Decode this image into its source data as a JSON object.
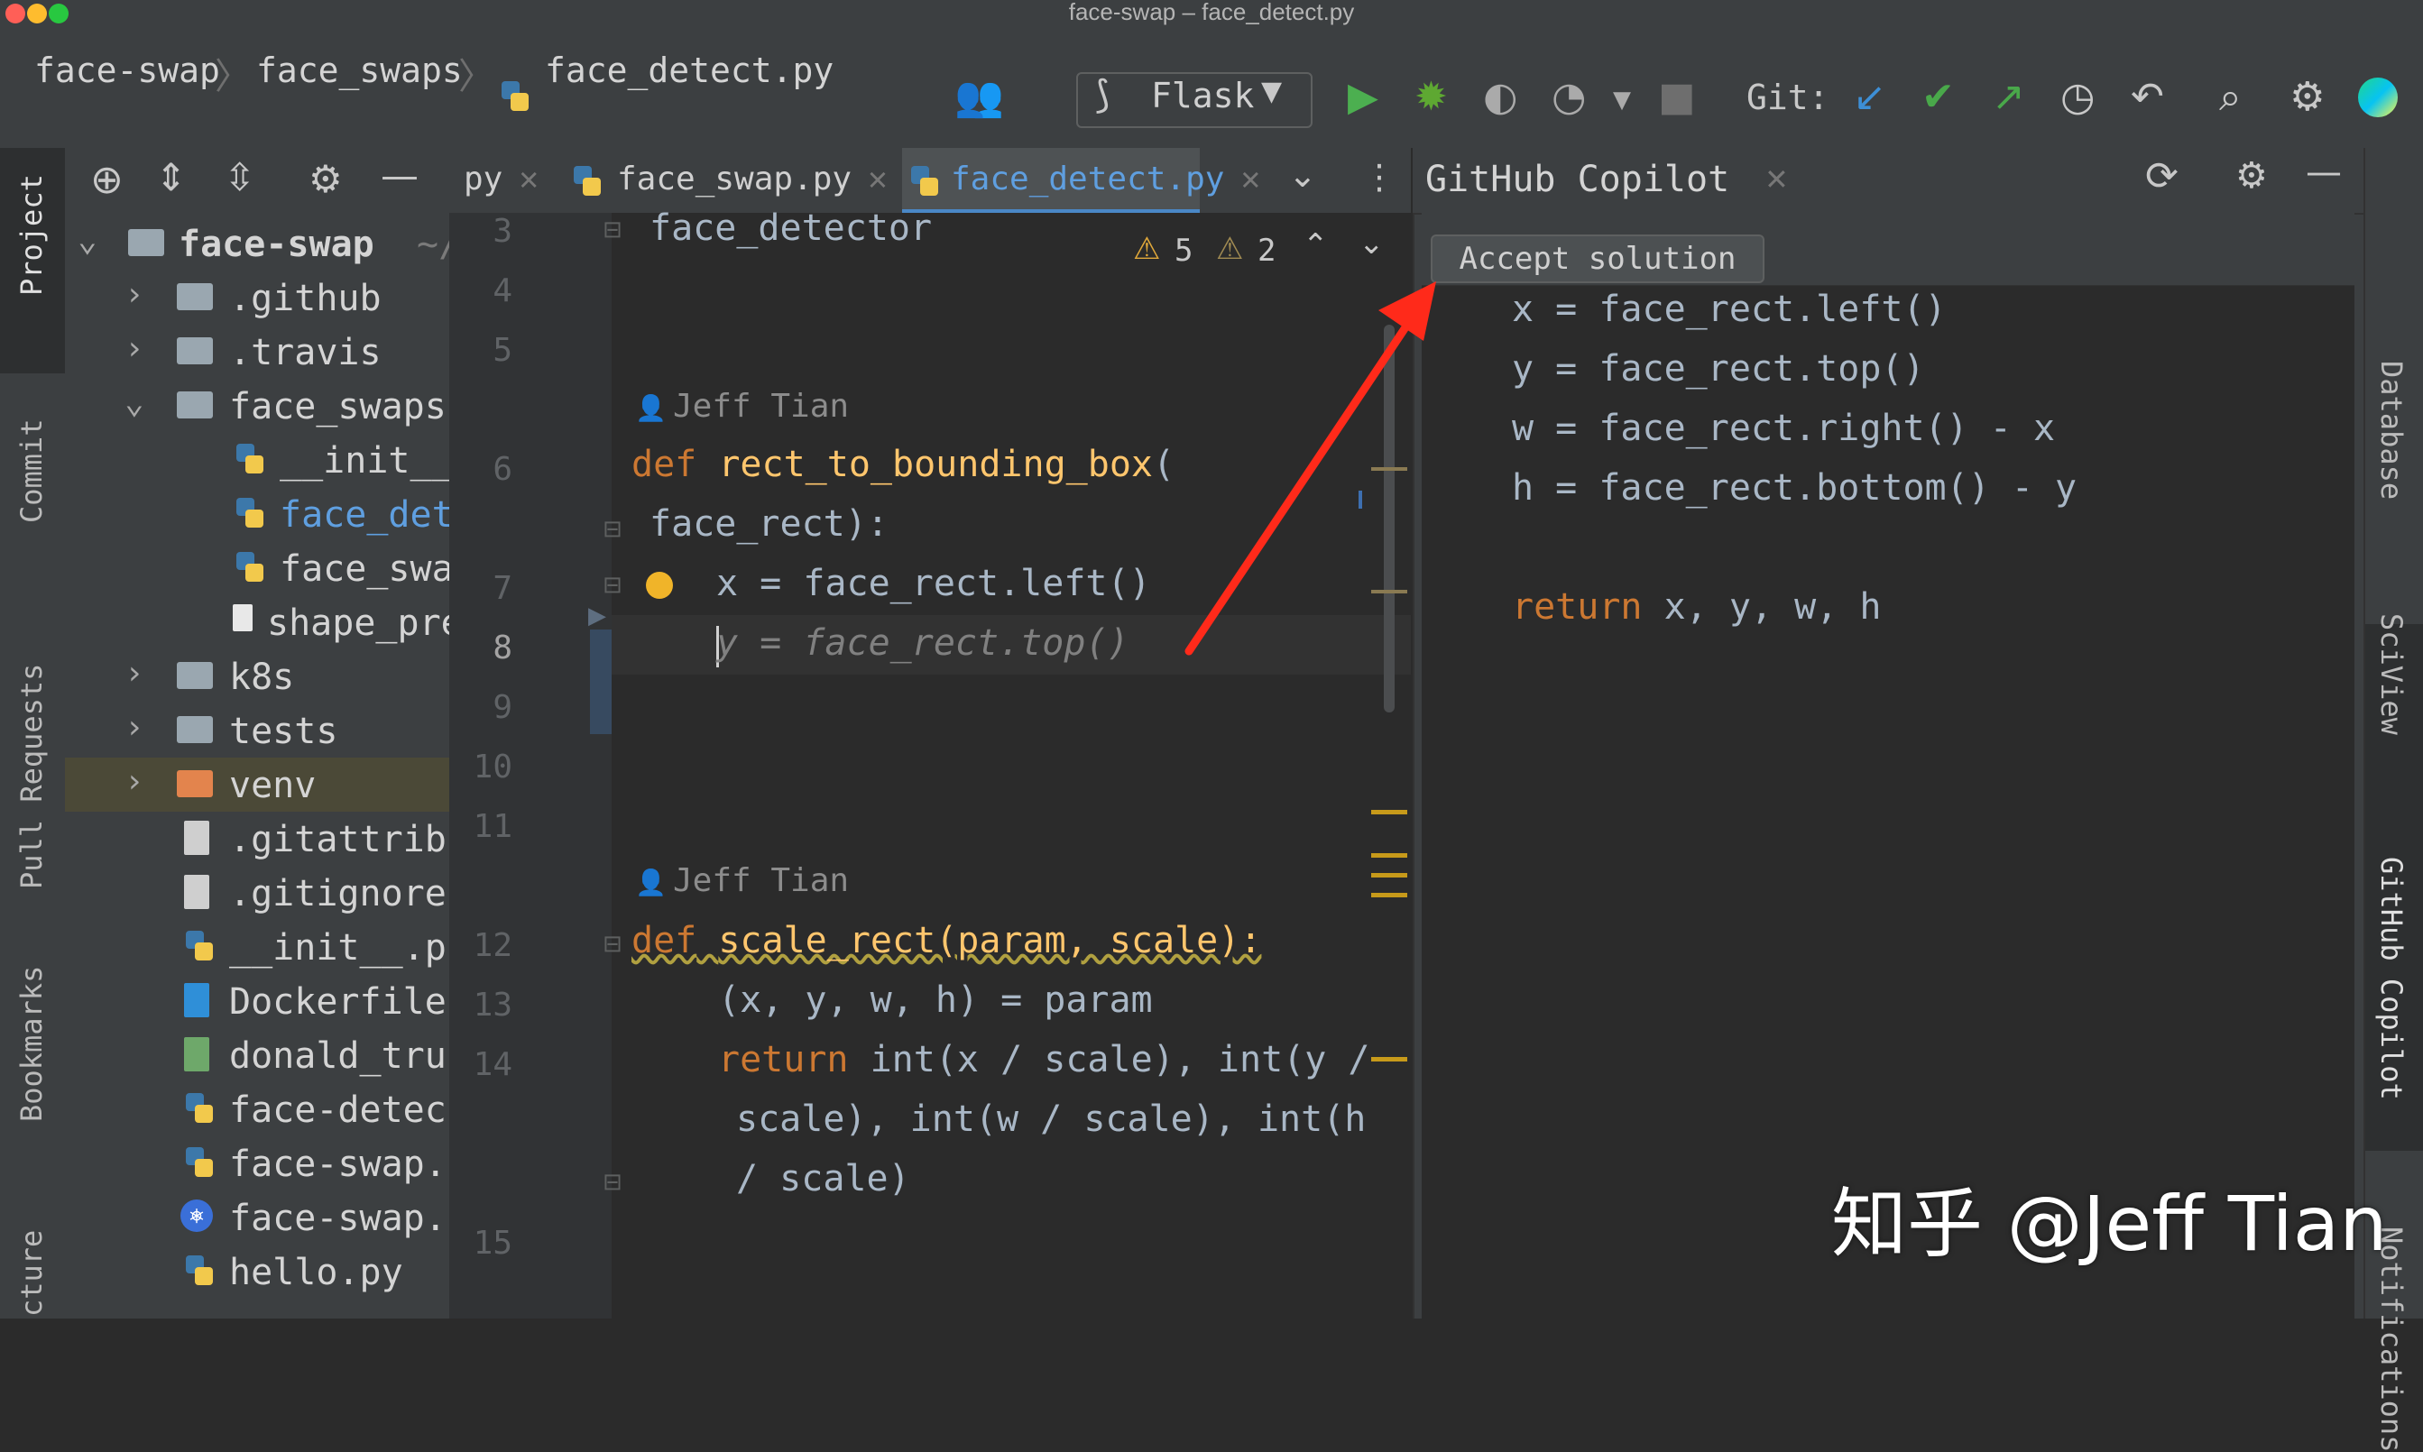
{
  "window": {
    "title": "face-swap – face_detect.py"
  },
  "breadcrumb": [
    "face-swap",
    "face_swaps",
    "face_detect.py"
  ],
  "run_config": {
    "label": "Flask"
  },
  "git": {
    "label": "Git:"
  },
  "left_strip": {
    "project": "Project",
    "commit": "Commit",
    "pull_requests": "Pull Requests",
    "bookmarks": "Bookmarks",
    "structure": "cture"
  },
  "project_tree": {
    "root": "face-swap",
    "root_suffix": "~/",
    "items": [
      {
        "label": ".github",
        "kind": "folder",
        "expanded": false
      },
      {
        "label": ".travis",
        "kind": "folder",
        "expanded": false
      },
      {
        "label": "face_swaps",
        "kind": "folder",
        "expanded": true
      },
      {
        "label": "__init__",
        "kind": "python"
      },
      {
        "label": "face_det",
        "kind": "python",
        "selected": true
      },
      {
        "label": "face_swa",
        "kind": "python"
      },
      {
        "label": "shape_pre",
        "kind": "file"
      },
      {
        "label": "k8s",
        "kind": "folder",
        "expanded": false
      },
      {
        "label": "tests",
        "kind": "folder",
        "expanded": false
      },
      {
        "label": "venv",
        "kind": "folder-excluded",
        "expanded": false
      },
      {
        "label": ".gitattrib",
        "kind": "file"
      },
      {
        "label": ".gitignore",
        "kind": "file"
      },
      {
        "label": "__init__.p",
        "kind": "python"
      },
      {
        "label": "Dockerfile",
        "kind": "docker"
      },
      {
        "label": "donald_tru",
        "kind": "image"
      },
      {
        "label": "face-detec",
        "kind": "python"
      },
      {
        "label": "face-swap.",
        "kind": "python"
      },
      {
        "label": "face-swap.",
        "kind": "helm"
      },
      {
        "label": "hello.py",
        "kind": "python"
      }
    ]
  },
  "editor_tabs": [
    {
      "label": "py",
      "active": false
    },
    {
      "label": "face_swap.py",
      "active": false
    },
    {
      "label": "face_detect.py",
      "active": true
    }
  ],
  "inspections": {
    "warnings": "5",
    "weak_warnings": "2"
  },
  "editor": {
    "line_numbers": [
      "3",
      "4",
      "5",
      "6",
      "7",
      "8",
      "9",
      "10",
      "11",
      "12",
      "13",
      "14",
      "15"
    ],
    "author_1": "Jeff Tian",
    "author_2": "Jeff Tian",
    "line3": "face_detector",
    "def1_kw": "def",
    "def1_name": "rect_to_bounding_box",
    "def1_open": "(",
    "def1_params": "face_rect):",
    "line7": "x = face_rect.left()",
    "line8_ghost": "y = face_rect.top()",
    "def2_kw": "def",
    "def2_rest": "scale_rect(param, scale):",
    "line13": "(x, y, w, h) = param",
    "ret_kw": "return",
    "ret_l1": "int(x / scale), int(y /",
    "ret_l2": "scale), int(w / scale), int(h",
    "ret_l3": "/ scale)"
  },
  "copilot": {
    "title": "GitHub Copilot",
    "accept_label": "Accept solution",
    "lines": [
      "x = face_rect.left()",
      "y = face_rect.top()",
      "w = face_rect.right() - x",
      "h = face_rect.bottom() - y"
    ],
    "return_kw": "return",
    "return_rest": "x, y, w, h"
  },
  "right_strip": {
    "database": "Database",
    "sciview": "SciView",
    "copilot": "GitHub Copilot",
    "notifications": "Notifications"
  },
  "watermark": "知乎 @Jeff Tian",
  "colors": {
    "keyword": "#cc7832",
    "function": "#ffc66d",
    "accent": "#4a88c7",
    "arrow": "#ff2a1a"
  }
}
